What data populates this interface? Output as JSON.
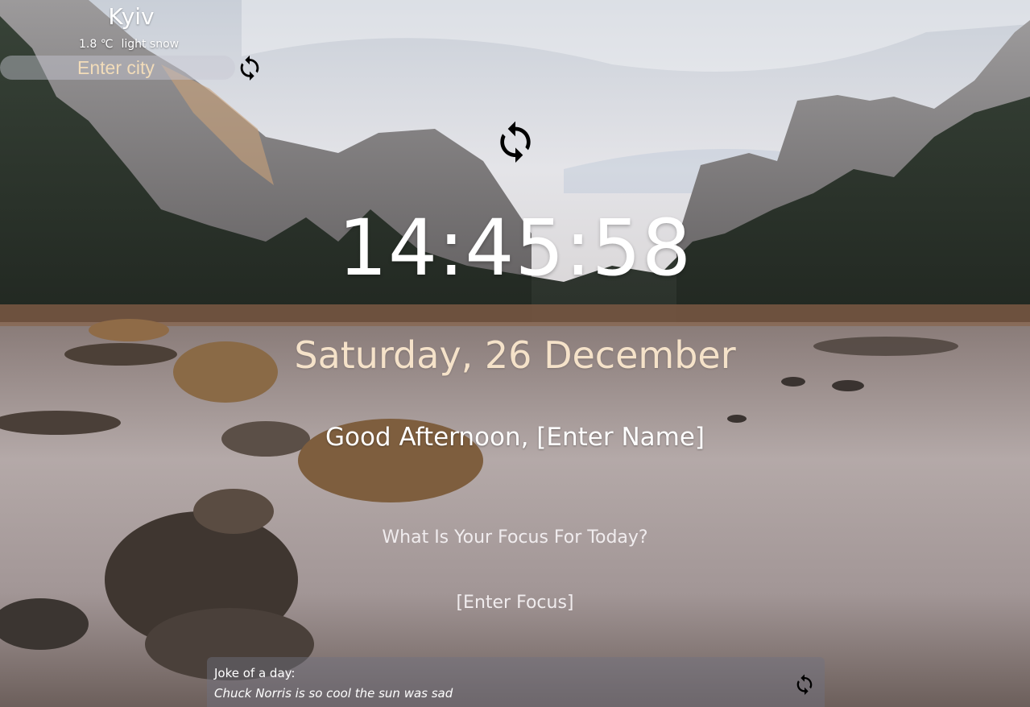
{
  "weather": {
    "city": "Kyiv",
    "temperature": "1.8 ℃",
    "description": "light snow",
    "city_input_placeholder": "Enter city",
    "refresh_icon": "refresh-icon"
  },
  "background": {
    "change_icon": "refresh-icon"
  },
  "clock": {
    "time": "14:45:58"
  },
  "date": {
    "text": "Saturday, 26 December"
  },
  "greeting": {
    "salutation": "Good Afternoon, ",
    "name": "[Enter Name]"
  },
  "focus": {
    "question": "What Is Your Focus For Today?",
    "value": "[Enter Focus]"
  },
  "joke": {
    "title": "Joke of a day:",
    "text": "Chuck Norris is so cool the sun was sad",
    "refresh_icon": "refresh-icon"
  },
  "colors": {
    "date_text": "#f5e2c9",
    "city_input_text": "#f2dcb9",
    "primary_text": "#ffffff"
  }
}
